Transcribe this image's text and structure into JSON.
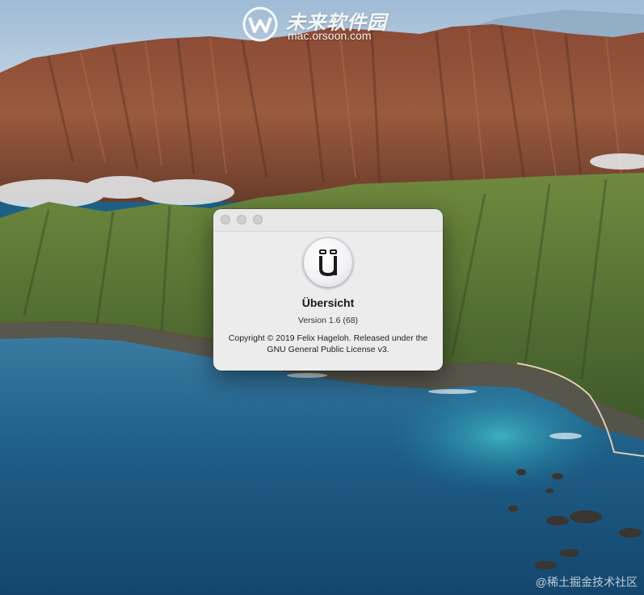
{
  "desktop": {
    "wallpaper": "macOS Big Sur coastline"
  },
  "watermarks": {
    "top_brand": "未来软件园",
    "top_url": "mac.orsoon.com",
    "bottom_text": "@稀土掘金技术社区",
    "logo_icon": "orsoon-w-logo-icon"
  },
  "about_window": {
    "traffic_lights": [
      "close",
      "minimize",
      "zoom"
    ],
    "app_icon": "ubersicht-icon",
    "app_name": "Übersicht",
    "version": "Version 1.6 (68)",
    "copyright": "Copyright © 2019 Felix Hageloh. Released under the GNU General Public License v3."
  },
  "colors": {
    "window_bg": "#ececec",
    "traffic_inactive": "#cfcfcf",
    "sea": "#1e5f86",
    "sky": "#b9cfe0"
  }
}
